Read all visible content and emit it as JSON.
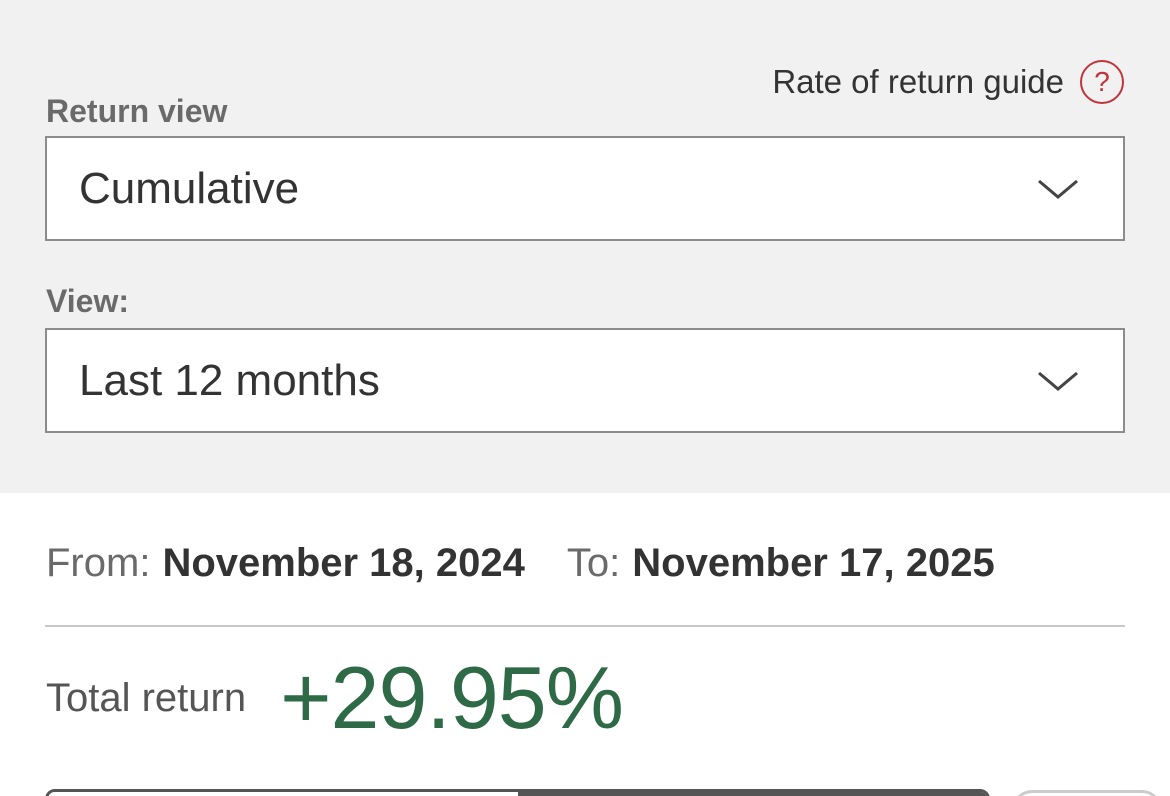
{
  "guide": {
    "label": "Rate of return guide",
    "icon_glyph": "?",
    "icon_name": "help-circle-icon",
    "icon_color": "#c0343b"
  },
  "return_view": {
    "label": "Return view",
    "selected": "Cumulative"
  },
  "view": {
    "label": "View:",
    "selected": "Last 12 months"
  },
  "dates": {
    "from_label": "From:",
    "from_value": "November 18, 2024",
    "to_label": "To:",
    "to_value": "November 17, 2025"
  },
  "total": {
    "label": "Total return",
    "value": "+29.95%",
    "color": "#2d6a45"
  }
}
